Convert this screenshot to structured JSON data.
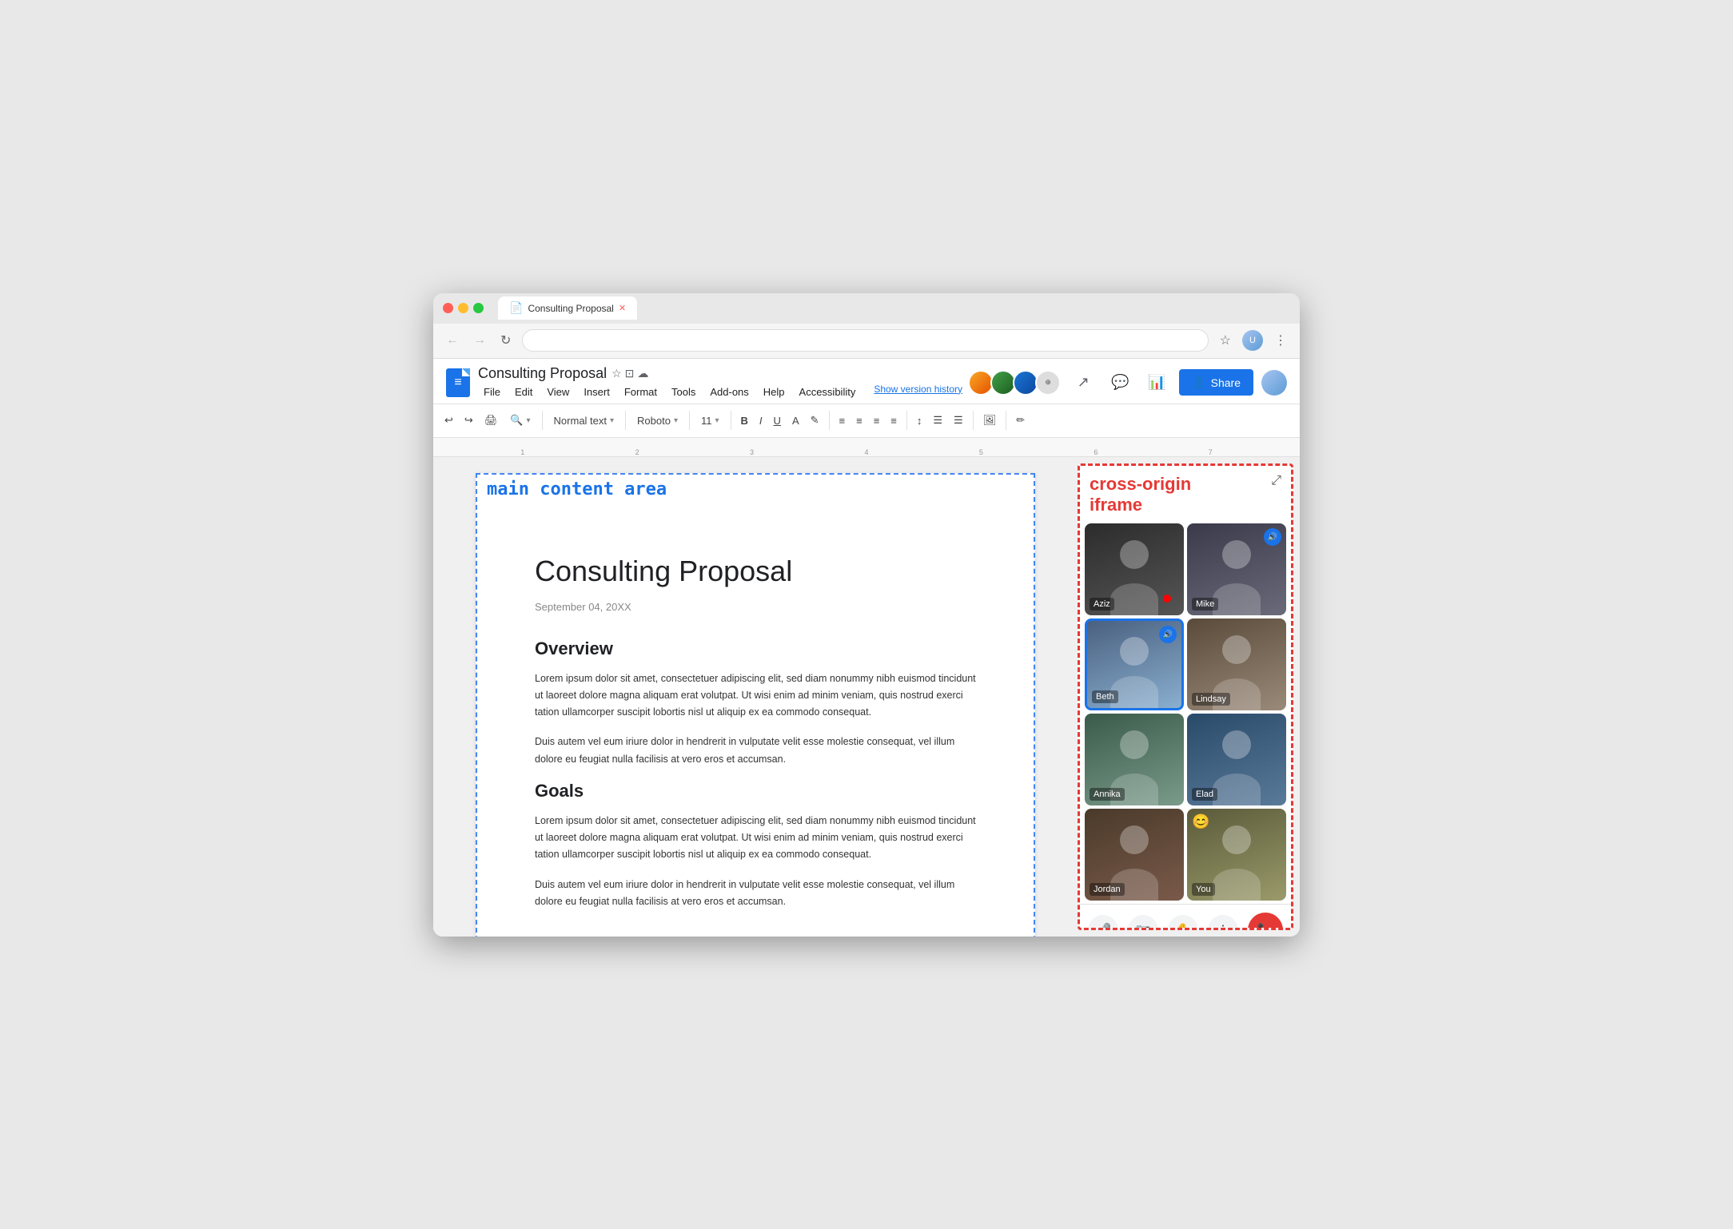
{
  "browser": {
    "tab_title": "Consulting Proposal",
    "tab_icon": "📄",
    "url": ""
  },
  "toolbar": {
    "undo": "↩",
    "redo": "↪",
    "print": "🖨",
    "zoom": "🔍",
    "style_dropdown": "Normal text",
    "font_dropdown": "Roboto",
    "size_dropdown": "11",
    "bold": "B",
    "italic": "I",
    "underline": "U",
    "text_color": "A",
    "highlight": "✎",
    "align_left": "≡",
    "align_center": "≡",
    "align_right": "≡",
    "justify": "≡",
    "line_spacing": "↕",
    "bullets": "☰",
    "numbered": "☰",
    "image": "🖼",
    "edit": "✏"
  },
  "docs": {
    "filename": "Consulting Proposal",
    "menu_items": [
      "File",
      "Edit",
      "View",
      "Insert",
      "Format",
      "Tools",
      "Add-ons",
      "Help",
      "Accessibility"
    ],
    "show_version": "Show version history",
    "share_btn": "Share",
    "main_content_label": "main content area"
  },
  "document": {
    "title": "Consulting Proposal",
    "date": "September 04, 20XX",
    "section1_heading": "Overview",
    "section1_para1": "Lorem ipsum dolor sit amet, consectetuer adipiscing elit, sed diam nonummy nibh euismod tincidunt ut laoreet dolore magna aliquam erat volutpat. Ut wisi enim ad minim veniam, quis nostrud exerci tation ullamcorper suscipit lobortis nisl ut aliquip ex ea commodo consequat.",
    "section1_para2": "Duis autem vel eum iriure dolor in hendrerit in vulputate velit esse molestie consequat, vel illum dolore eu feugiat nulla facilisis at vero eros et accumsan.",
    "section2_heading": "Goals",
    "section2_para1": "Lorem ipsum dolor sit amet, consectetuer adipiscing elit, sed diam nonummy nibh euismod tincidunt ut laoreet dolore magna aliquam erat volutpat. Ut wisi enim ad minim veniam, quis nostrud exerci tation ullamcorper suscipit lobortis nisl ut aliquip ex ea commodo consequat.",
    "section2_para2": "Duis autem vel eum iriure dolor in hendrerit in vulputate velit esse molestie consequat, vel illum dolore eu feugiat nulla facilisis at vero eros et accumsan."
  },
  "iframe": {
    "title": "cross-origin\niframe",
    "expand_icon": "⤢",
    "participants": [
      {
        "id": "aziz",
        "name": "Aziz",
        "active": false,
        "has_red_dot": true
      },
      {
        "id": "mike",
        "name": "Mike",
        "active": false,
        "speaking": true
      },
      {
        "id": "beth",
        "name": "Beth",
        "active": true,
        "speaking": true
      },
      {
        "id": "lindsay",
        "name": "Lindsay",
        "active": false
      },
      {
        "id": "annika",
        "name": "Annika",
        "active": false
      },
      {
        "id": "elad",
        "name": "Elad",
        "active": false
      },
      {
        "id": "jordan",
        "name": "Jordan",
        "active": false
      },
      {
        "id": "you",
        "name": "You",
        "active": false,
        "emoji": "😊"
      }
    ],
    "controls": {
      "mic": "🎤",
      "camera": "📷",
      "hand": "✋",
      "more": "⋮",
      "end_call": "📞"
    }
  },
  "colors": {
    "brand_blue": "#1a73e8",
    "red_border": "#e53935",
    "main_content_blue": "#1a73e8"
  }
}
